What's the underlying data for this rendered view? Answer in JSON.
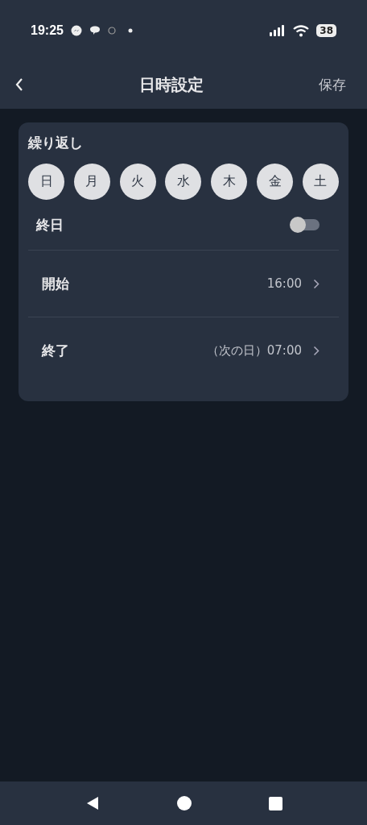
{
  "status_bar": {
    "time": "19:25",
    "battery": "38"
  },
  "header": {
    "title": "日時設定",
    "save": "保存"
  },
  "repeat": {
    "title": "繰り返し",
    "days": [
      {
        "label": "日",
        "selected": false
      },
      {
        "label": "月",
        "selected": false
      },
      {
        "label": "火",
        "selected": false
      },
      {
        "label": "水",
        "selected": false
      },
      {
        "label": "木",
        "selected": false
      },
      {
        "label": "金",
        "selected": false
      },
      {
        "label": "土",
        "selected": false
      }
    ]
  },
  "all_day": {
    "label": "終日",
    "on": false
  },
  "times": [
    {
      "label": "開始",
      "value": "16:00"
    },
    {
      "label": "終了",
      "value": "（次の日）07:00"
    }
  ]
}
